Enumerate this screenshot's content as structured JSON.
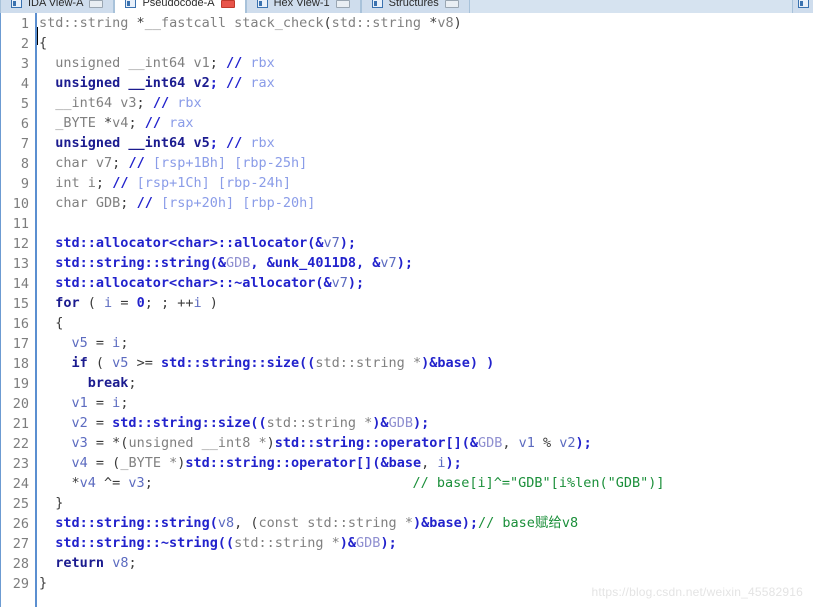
{
  "window": {
    "tabs": [
      {
        "label": "IDA View-A",
        "icon": "document-icon",
        "close": "close-box",
        "active": false
      },
      {
        "label": "Pseudocode-A",
        "icon": "document-icon",
        "close": "close-box-red",
        "active": true
      },
      {
        "label": "Hex View-1",
        "icon": "document-icon",
        "close": "close-box",
        "active": false
      },
      {
        "label": "Structures",
        "icon": "document-icon",
        "close": "close-box",
        "active": false
      }
    ],
    "tab_overflow_icon": "document-icon"
  },
  "editor": {
    "language": "c",
    "first_line": 1,
    "last_line": 29,
    "watermark": "https://blog.csdn.net/weixin_45582916",
    "lines": [
      {
        "n": 1,
        "tokens": [
          {
            "t": "std::string ",
            "c": "kw"
          },
          {
            "t": "*",
            "c": "punc"
          },
          {
            "t": "__fastcall ",
            "c": "kw"
          },
          {
            "t": "stack_check",
            "c": "kw"
          },
          {
            "t": "(",
            "c": "punc"
          },
          {
            "t": "std::string ",
            "c": "kw"
          },
          {
            "t": "*",
            "c": "punc"
          },
          {
            "t": "v8",
            "c": "kw"
          },
          {
            "t": ")",
            "c": "punc"
          }
        ]
      },
      {
        "n": 2,
        "tokens": [
          {
            "t": "{",
            "c": "punc"
          }
        ]
      },
      {
        "n": 3,
        "tokens": [
          {
            "t": "  unsigned __int64 ",
            "c": "kw"
          },
          {
            "t": "v1",
            "c": "kw"
          },
          {
            "t": ";",
            "c": "punc"
          },
          {
            "t": " // ",
            "c": "cmtop"
          },
          {
            "t": "rbx",
            "c": "cmttxt"
          }
        ]
      },
      {
        "n": 4,
        "tokens": [
          {
            "t": "  unsigned __int64 ",
            "c": "kwb"
          },
          {
            "t": "v2",
            "c": "kwb"
          },
          {
            "t": ";",
            "c": "num"
          },
          {
            "t": " // ",
            "c": "cmtop"
          },
          {
            "t": "rax",
            "c": "cmttxt"
          }
        ]
      },
      {
        "n": 5,
        "tokens": [
          {
            "t": "  __int64 ",
            "c": "kw"
          },
          {
            "t": "v3",
            "c": "kw"
          },
          {
            "t": ";",
            "c": "punc"
          },
          {
            "t": " // ",
            "c": "cmtop"
          },
          {
            "t": "rbx",
            "c": "cmttxt"
          }
        ]
      },
      {
        "n": 6,
        "tokens": [
          {
            "t": "  _BYTE ",
            "c": "kw"
          },
          {
            "t": "*",
            "c": "punc"
          },
          {
            "t": "v4",
            "c": "kw"
          },
          {
            "t": ";",
            "c": "punc"
          },
          {
            "t": " // ",
            "c": "cmtop"
          },
          {
            "t": "rax",
            "c": "cmttxt"
          }
        ]
      },
      {
        "n": 7,
        "tokens": [
          {
            "t": "  unsigned __int64 ",
            "c": "kwb"
          },
          {
            "t": "v5",
            "c": "kwb"
          },
          {
            "t": ";",
            "c": "num"
          },
          {
            "t": " // ",
            "c": "cmtop"
          },
          {
            "t": "rbx",
            "c": "cmttxt"
          }
        ]
      },
      {
        "n": 8,
        "tokens": [
          {
            "t": "  char ",
            "c": "kw"
          },
          {
            "t": "v7",
            "c": "kw"
          },
          {
            "t": ";",
            "c": "punc"
          },
          {
            "t": " // ",
            "c": "cmtop"
          },
          {
            "t": "[rsp+1Bh] [rbp-25h]",
            "c": "cmttxt"
          }
        ]
      },
      {
        "n": 9,
        "tokens": [
          {
            "t": "  int ",
            "c": "kw"
          },
          {
            "t": "i",
            "c": "kw"
          },
          {
            "t": ";",
            "c": "punc"
          },
          {
            "t": " // ",
            "c": "cmtop"
          },
          {
            "t": "[rsp+1Ch] [rbp-24h]",
            "c": "cmttxt"
          }
        ]
      },
      {
        "n": 10,
        "tokens": [
          {
            "t": "  char ",
            "c": "kw"
          },
          {
            "t": "GDB",
            "c": "kw"
          },
          {
            "t": ";",
            "c": "punc"
          },
          {
            "t": " // ",
            "c": "cmtop"
          },
          {
            "t": "[rsp+20h] [rbp-20h]",
            "c": "cmttxt"
          }
        ]
      },
      {
        "n": 11,
        "tokens": []
      },
      {
        "n": 12,
        "tokens": [
          {
            "t": "  ",
            "c": "plain"
          },
          {
            "t": "std::allocator<char>::allocator",
            "c": "fn"
          },
          {
            "t": "(&",
            "c": "amp"
          },
          {
            "t": "v7",
            "c": "var"
          },
          {
            "t": ");",
            "c": "amp"
          }
        ]
      },
      {
        "n": 13,
        "tokens": [
          {
            "t": "  ",
            "c": "plain"
          },
          {
            "t": "std::string::string",
            "c": "fn"
          },
          {
            "t": "(&",
            "c": "amp"
          },
          {
            "t": "GDB",
            "c": "varname"
          },
          {
            "t": ", &",
            "c": "amp"
          },
          {
            "t": "unk_4011D8",
            "c": "fn"
          },
          {
            "t": ", &",
            "c": "amp"
          },
          {
            "t": "v7",
            "c": "var"
          },
          {
            "t": ");",
            "c": "amp"
          }
        ]
      },
      {
        "n": 14,
        "tokens": [
          {
            "t": "  ",
            "c": "plain"
          },
          {
            "t": "std::allocator<char>::~allocator",
            "c": "fn"
          },
          {
            "t": "(&",
            "c": "amp"
          },
          {
            "t": "v7",
            "c": "var"
          },
          {
            "t": ");",
            "c": "amp"
          }
        ]
      },
      {
        "n": 15,
        "tokens": [
          {
            "t": "  ",
            "c": "plain"
          },
          {
            "t": "for",
            "c": "kwb"
          },
          {
            "t": " ( ",
            "c": "punc"
          },
          {
            "t": "i",
            "c": "var"
          },
          {
            "t": " = ",
            "c": "punc"
          },
          {
            "t": "0",
            "c": "num"
          },
          {
            "t": "; ; ++",
            "c": "punc"
          },
          {
            "t": "i",
            "c": "var"
          },
          {
            "t": " )",
            "c": "punc"
          }
        ]
      },
      {
        "n": 16,
        "tokens": [
          {
            "t": "  {",
            "c": "punc"
          }
        ]
      },
      {
        "n": 17,
        "tokens": [
          {
            "t": "    ",
            "c": "plain"
          },
          {
            "t": "v5",
            "c": "var"
          },
          {
            "t": " = ",
            "c": "punc"
          },
          {
            "t": "i",
            "c": "var"
          },
          {
            "t": ";",
            "c": "punc"
          }
        ]
      },
      {
        "n": 18,
        "tokens": [
          {
            "t": "    ",
            "c": "plain"
          },
          {
            "t": "if",
            "c": "kwb"
          },
          {
            "t": " ( ",
            "c": "punc"
          },
          {
            "t": "v5",
            "c": "var"
          },
          {
            "t": " >= ",
            "c": "punc"
          },
          {
            "t": "std::string::size",
            "c": "fn"
          },
          {
            "t": "((",
            "c": "amp"
          },
          {
            "t": "std::string ",
            "c": "kw"
          },
          {
            "t": "*",
            "c": "kw"
          },
          {
            "t": ")&",
            "c": "amp"
          },
          {
            "t": "base",
            "c": "amp"
          },
          {
            "t": ") )",
            "c": "amp"
          }
        ]
      },
      {
        "n": 19,
        "tokens": [
          {
            "t": "      ",
            "c": "plain"
          },
          {
            "t": "break",
            "c": "kwb"
          },
          {
            "t": ";",
            "c": "punc"
          }
        ]
      },
      {
        "n": 20,
        "tokens": [
          {
            "t": "    ",
            "c": "plain"
          },
          {
            "t": "v1",
            "c": "var"
          },
          {
            "t": " = ",
            "c": "punc"
          },
          {
            "t": "i",
            "c": "var"
          },
          {
            "t": ";",
            "c": "punc"
          }
        ]
      },
      {
        "n": 21,
        "tokens": [
          {
            "t": "    ",
            "c": "plain"
          },
          {
            "t": "v2",
            "c": "var"
          },
          {
            "t": " = ",
            "c": "punc"
          },
          {
            "t": "std::string::size",
            "c": "fn"
          },
          {
            "t": "((",
            "c": "amp"
          },
          {
            "t": "std::string ",
            "c": "kw"
          },
          {
            "t": "*",
            "c": "kw"
          },
          {
            "t": ")&",
            "c": "amp"
          },
          {
            "t": "GDB",
            "c": "varname"
          },
          {
            "t": ");",
            "c": "amp"
          }
        ]
      },
      {
        "n": 22,
        "tokens": [
          {
            "t": "    ",
            "c": "plain"
          },
          {
            "t": "v3",
            "c": "var"
          },
          {
            "t": " = ",
            "c": "punc"
          },
          {
            "t": "*(",
            "c": "punc"
          },
          {
            "t": "unsigned __int8 ",
            "c": "kw"
          },
          {
            "t": "*",
            "c": "kw"
          },
          {
            "t": ")",
            "c": "punc"
          },
          {
            "t": "std::string::operator[]",
            "c": "fn"
          },
          {
            "t": "(&",
            "c": "amp"
          },
          {
            "t": "GDB",
            "c": "varname"
          },
          {
            "t": ", ",
            "c": "punc"
          },
          {
            "t": "v1",
            "c": "var"
          },
          {
            "t": " % ",
            "c": "punc"
          },
          {
            "t": "v2",
            "c": "var"
          },
          {
            "t": ");",
            "c": "amp"
          }
        ]
      },
      {
        "n": 23,
        "tokens": [
          {
            "t": "    ",
            "c": "plain"
          },
          {
            "t": "v4",
            "c": "var"
          },
          {
            "t": " = ",
            "c": "punc"
          },
          {
            "t": "(",
            "c": "punc"
          },
          {
            "t": "_BYTE ",
            "c": "kw"
          },
          {
            "t": "*",
            "c": "kw"
          },
          {
            "t": ")",
            "c": "punc"
          },
          {
            "t": "std::string::operator[]",
            "c": "fn"
          },
          {
            "t": "(&",
            "c": "amp"
          },
          {
            "t": "base",
            "c": "amp"
          },
          {
            "t": ", ",
            "c": "punc"
          },
          {
            "t": "i",
            "c": "var"
          },
          {
            "t": ");",
            "c": "amp"
          }
        ]
      },
      {
        "n": 24,
        "tokens": [
          {
            "t": "    *",
            "c": "punc"
          },
          {
            "t": "v4",
            "c": "var"
          },
          {
            "t": " ^= ",
            "c": "punc"
          },
          {
            "t": "v3",
            "c": "var"
          },
          {
            "t": ";",
            "c": "punc"
          }
        ],
        "trailing_comment": {
          "text": "// base[i]^=\"GDB\"[i%len(\"GDB\")]",
          "col": 46
        }
      },
      {
        "n": 25,
        "tokens": [
          {
            "t": "  }",
            "c": "punc"
          }
        ]
      },
      {
        "n": 26,
        "tokens": [
          {
            "t": "  ",
            "c": "plain"
          },
          {
            "t": "std::string::string",
            "c": "fn"
          },
          {
            "t": "(",
            "c": "amp"
          },
          {
            "t": "v8",
            "c": "var"
          },
          {
            "t": ", (",
            "c": "punc"
          },
          {
            "t": "const std::string ",
            "c": "kw"
          },
          {
            "t": "*",
            "c": "kw"
          },
          {
            "t": ")&",
            "c": "amp"
          },
          {
            "t": "base",
            "c": "amp"
          },
          {
            "t": ");",
            "c": "amp"
          },
          {
            "t": "// base赋给v8",
            "c": "cmt"
          }
        ]
      },
      {
        "n": 27,
        "tokens": [
          {
            "t": "  ",
            "c": "plain"
          },
          {
            "t": "std::string::~string",
            "c": "fn"
          },
          {
            "t": "((",
            "c": "amp"
          },
          {
            "t": "std::string ",
            "c": "kw"
          },
          {
            "t": "*",
            "c": "kw"
          },
          {
            "t": ")&",
            "c": "amp"
          },
          {
            "t": "GDB",
            "c": "varname"
          },
          {
            "t": ");",
            "c": "amp"
          }
        ]
      },
      {
        "n": 28,
        "tokens": [
          {
            "t": "  ",
            "c": "plain"
          },
          {
            "t": "return",
            "c": "kwb"
          },
          {
            "t": " ",
            "c": "punc"
          },
          {
            "t": "v8",
            "c": "var"
          },
          {
            "t": ";",
            "c": "punc"
          }
        ]
      },
      {
        "n": 29,
        "tokens": [
          {
            "t": "}",
            "c": "punc"
          }
        ]
      }
    ]
  }
}
